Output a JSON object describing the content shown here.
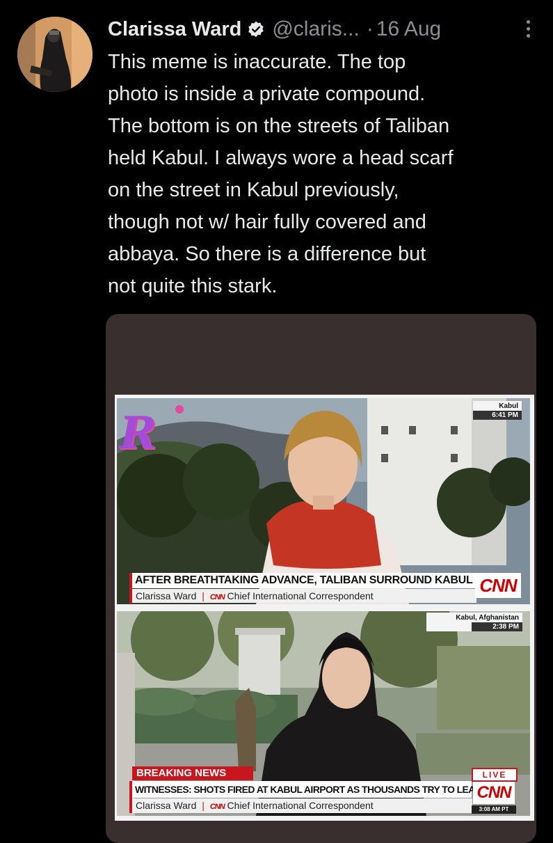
{
  "tweet": {
    "author_name": "Clarissa Ward",
    "handle": "@claris...",
    "separator": "·",
    "time": "16 Aug",
    "text_lines": [
      "This meme is inaccurate. The top",
      "photo is inside a private compound.",
      "The bottom is on the streets of Taliban",
      "held Kabul. I always wore a head scarf",
      "on the street in Kabul previously,",
      "though not w/ hair fully covered and",
      "abbaya. So there is a difference but",
      "not quite this stark."
    ]
  },
  "top_shot": {
    "location": "Kabul",
    "time": "6:41 PM",
    "headline": "AFTER BREATHTAKING ADVANCE, TALIBAN SURROUND KABUL",
    "reporter": "Clarissa Ward",
    "network_small": "CNN",
    "reporter_title": "Chief International Correspondent",
    "network_logo": "CNN",
    "watermark": "R"
  },
  "bottom_shot": {
    "location": "Kabul, Afghanistan",
    "time": "2:38 PM",
    "breaking": "BREAKING NEWS",
    "headline": "WITNESSES: SHOTS FIRED AT KABUL AIRPORT AS THOUSANDS TRY TO LEAVE",
    "reporter": "Clarissa Ward",
    "network_small": "CNN",
    "reporter_title": "Chief International Correspondent",
    "live": "LIVE",
    "network_logo": "CNN",
    "logo_time": "3:08 AM PT"
  },
  "colors": {
    "background": "#000000",
    "text": "#e7e9ea",
    "muted": "#8b8f94",
    "verified": "#e7e9ea",
    "media_bg": "#392f2f",
    "cnn_red": "#cc0000"
  },
  "icons": [
    "verified-badge-icon",
    "more-options-icon"
  ]
}
